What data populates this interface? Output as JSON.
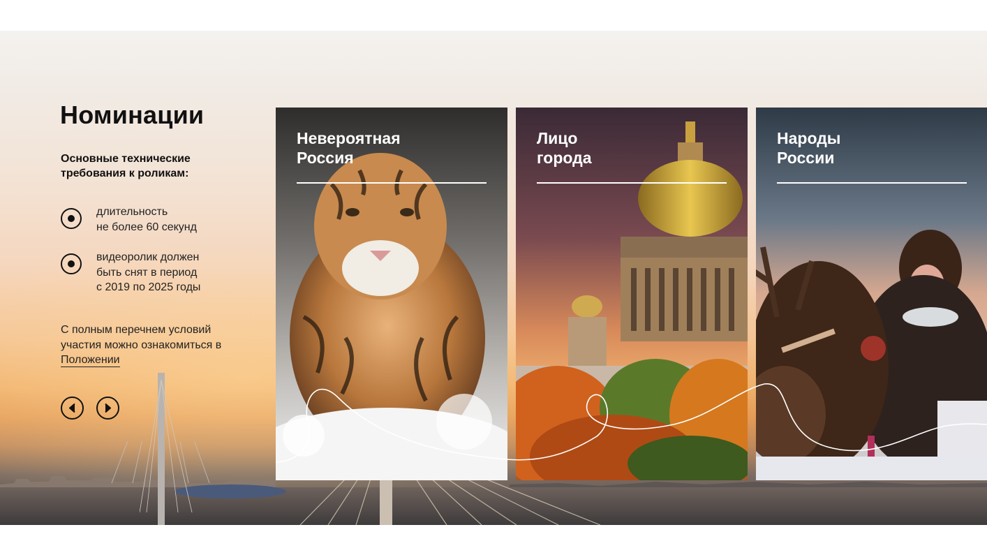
{
  "section": {
    "title": "Номинации",
    "subtitle": "Основные технические\nтребования к роликам:"
  },
  "requirements": [
    {
      "text": "длительность\nне более 60 секунд"
    },
    {
      "text": "видеоролик должен\nбыть снят в период\nс 2019 по 2025 годы"
    }
  ],
  "conditions": {
    "text": "С полным перечнем условий участия можно ознакомиться в",
    "link_label": "Положении"
  },
  "carousel": {
    "prev_icon": "chevron-left-icon",
    "next_icon": "chevron-right-icon"
  },
  "nominations": [
    {
      "title": "Невероятная\nРоссия",
      "image": "tiger-photo"
    },
    {
      "title": "Лицо\nгорода",
      "image": "cathedral-photo"
    },
    {
      "title": "Народы\nРоссии",
      "image": "reindeer-child-photo"
    }
  ],
  "colors": {
    "text": "#111111",
    "card_text": "#ffffff"
  }
}
